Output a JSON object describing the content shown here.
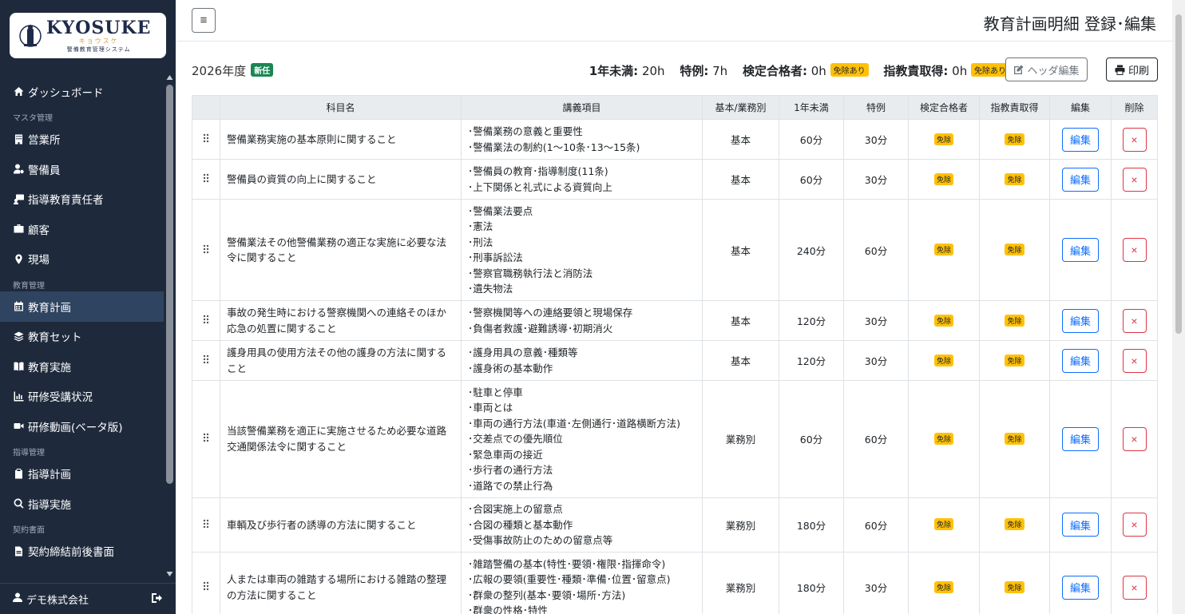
{
  "logo": {
    "title": "KYOSUKE",
    "kana": "キョウスケ",
    "subtitle": "警備教育管理システム"
  },
  "sidebar": {
    "items": [
      {
        "type": "item",
        "label": "ダッシュボード",
        "icon": "home-icon"
      },
      {
        "type": "section",
        "label": "マスタ管理"
      },
      {
        "type": "item",
        "label": "営業所",
        "icon": "building-icon"
      },
      {
        "type": "item",
        "label": "警備員",
        "icon": "user-gear-icon"
      },
      {
        "type": "item",
        "label": "指導教育責任者",
        "icon": "instructor-icon"
      },
      {
        "type": "item",
        "label": "顧客",
        "icon": "briefcase-icon"
      },
      {
        "type": "item",
        "label": "現場",
        "icon": "location-pin-icon"
      },
      {
        "type": "section",
        "label": "教育管理"
      },
      {
        "type": "item",
        "label": "教育計画",
        "icon": "calendar-icon",
        "active": true
      },
      {
        "type": "item",
        "label": "教育セット",
        "icon": "layers-icon"
      },
      {
        "type": "item",
        "label": "教育実施",
        "icon": "book-open-icon"
      },
      {
        "type": "item",
        "label": "研修受講状況",
        "icon": "chart-line-icon"
      },
      {
        "type": "item",
        "label": "研修動画(ベータ版)",
        "icon": "video-icon"
      },
      {
        "type": "section",
        "label": "指導管理"
      },
      {
        "type": "item",
        "label": "指導計画",
        "icon": "clipboard-icon"
      },
      {
        "type": "item",
        "label": "指導実施",
        "icon": "magnify-icon"
      },
      {
        "type": "section",
        "label": "契約書面"
      },
      {
        "type": "item",
        "label": "契約締結前後書面",
        "icon": "file-icon"
      }
    ],
    "footer_user": "デモ株式会社"
  },
  "header": {
    "menu_label": "≡",
    "title": "教育計画明細 登録･編集"
  },
  "info": {
    "year": "2026年度",
    "new_badge": "新任",
    "stat1_label": "1年未満:",
    "stat1_value": "20h",
    "stat2_label": "特例:",
    "stat2_value": "7h",
    "stat3_label": "検定合格者:",
    "stat3_value": "0h",
    "stat3_badge": "免除あり",
    "stat4_label": "指教責取得:",
    "stat4_value": "0h",
    "stat4_badge": "免除あり",
    "header_edit_label": "ヘッダ編集",
    "print_label": "印刷"
  },
  "table": {
    "headers": [
      "",
      "科目名",
      "講義項目",
      "基本/業務別",
      "1年未満",
      "特例",
      "検定合格者",
      "指教責取得",
      "編集",
      "削除"
    ],
    "edit_label": "編集",
    "delete_label": "×",
    "rows": [
      {
        "subject": "警備業務実施の基本原則に関すること",
        "items": [
          "･警備業務の意義と重要性",
          "･警備業法の制約(1～10条･13～15条)"
        ],
        "category": "基本",
        "under1": "60分",
        "special": "30分",
        "cert": "免除",
        "instr": "免除"
      },
      {
        "subject": "警備員の資質の向上に関すること",
        "items": [
          "･警備員の教育･指導制度(11条)",
          "･上下関係と礼式による資質向上"
        ],
        "category": "基本",
        "under1": "60分",
        "special": "30分",
        "cert": "免除",
        "instr": "免除"
      },
      {
        "subject": "警備業法その他警備業務の適正な実施に必要な法令に関すること",
        "items": [
          "･警備業法要点",
          "･憲法",
          "･刑法",
          "･刑事訴訟法",
          "･警察官職務執行法と消防法",
          "･遺失物法"
        ],
        "category": "基本",
        "under1": "240分",
        "special": "60分",
        "cert": "免除",
        "instr": "免除"
      },
      {
        "subject": "事故の発生時における警察機関への連絡そのほか応急の処置に関すること",
        "items": [
          "･警察機関等への連絡要領と現場保存",
          "･負傷者救護･避難誘導･初期消火"
        ],
        "category": "基本",
        "under1": "120分",
        "special": "30分",
        "cert": "免除",
        "instr": "免除"
      },
      {
        "subject": "護身用具の使用方法その他の護身の方法に関すること",
        "items": [
          "･護身用具の意義･種類等",
          "･護身術の基本動作"
        ],
        "category": "基本",
        "under1": "120分",
        "special": "30分",
        "cert": "免除",
        "instr": "免除"
      },
      {
        "subject": "当該警備業務を適正に実施させるため必要な道路交通関係法令に関すること",
        "items": [
          "･駐車と停車",
          "･車両とは",
          "･車両の通行方法(車道･左側通行･道路横断方法)",
          "･交差点での優先順位",
          "･緊急車両の接近",
          "･歩行者の通行方法",
          "･道路での禁止行為"
        ],
        "category": "業務別",
        "under1": "60分",
        "special": "60分",
        "cert": "免除",
        "instr": "免除"
      },
      {
        "subject": "車輌及び歩行者の誘導の方法に関すること",
        "items": [
          "･合図実施上の留意点",
          "･合図の種類と基本動作",
          "･受傷事故防止のための留意点等"
        ],
        "category": "業務別",
        "under1": "180分",
        "special": "60分",
        "cert": "免除",
        "instr": "免除"
      },
      {
        "subject": "人または車両の雑踏する場所における雑踏の整理の方法に関すること",
        "items": [
          "･雑踏警備の基本(特性･要領･権限･指揮命令)",
          "･広報の要領(重要性･種類･準備･位置･留意点)",
          "･群衆の整列(基本･要領･場所･方法)",
          "･群衆の性格･特性"
        ],
        "category": "業務別",
        "under1": "180分",
        "special": "30分",
        "cert": "免除",
        "instr": "免除"
      }
    ]
  }
}
